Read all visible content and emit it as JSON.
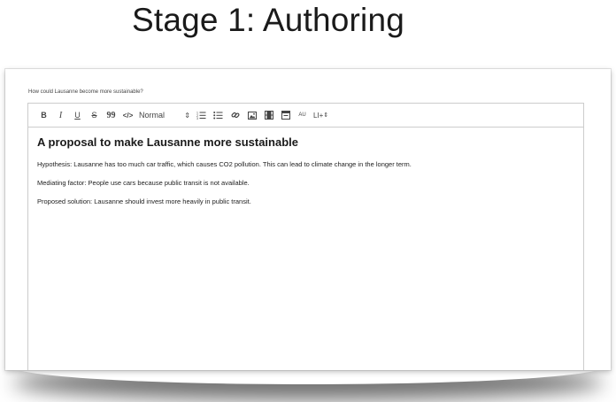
{
  "slide": {
    "title": "Stage 1: Authoring"
  },
  "question": "How could Lausanne become more sustainable?",
  "toolbar": {
    "bold": "B",
    "italic": "I",
    "underline": "U",
    "strike": "S",
    "quote": "99",
    "code": "</>",
    "block_format": "Normal",
    "au": "AU",
    "li": "LI+",
    "icons": [
      "bold-icon",
      "italic-icon",
      "underline-icon",
      "strikethrough-icon",
      "quote-icon",
      "code-icon",
      "ordered-list-icon",
      "bullet-list-icon",
      "link-icon",
      "image-icon",
      "video-icon",
      "table-icon"
    ]
  },
  "document": {
    "title": "A proposal to make Lausanne more sustainable",
    "paragraphs": [
      "Hypothesis: Lausanne has too much car traffic, which causes CO2 pollution. This can lead to climate change in the longer term.",
      "Mediating factor: People use cars because public transit is not available.",
      "Proposed solution: Lausanne should invest more heavily in public transit."
    ]
  }
}
